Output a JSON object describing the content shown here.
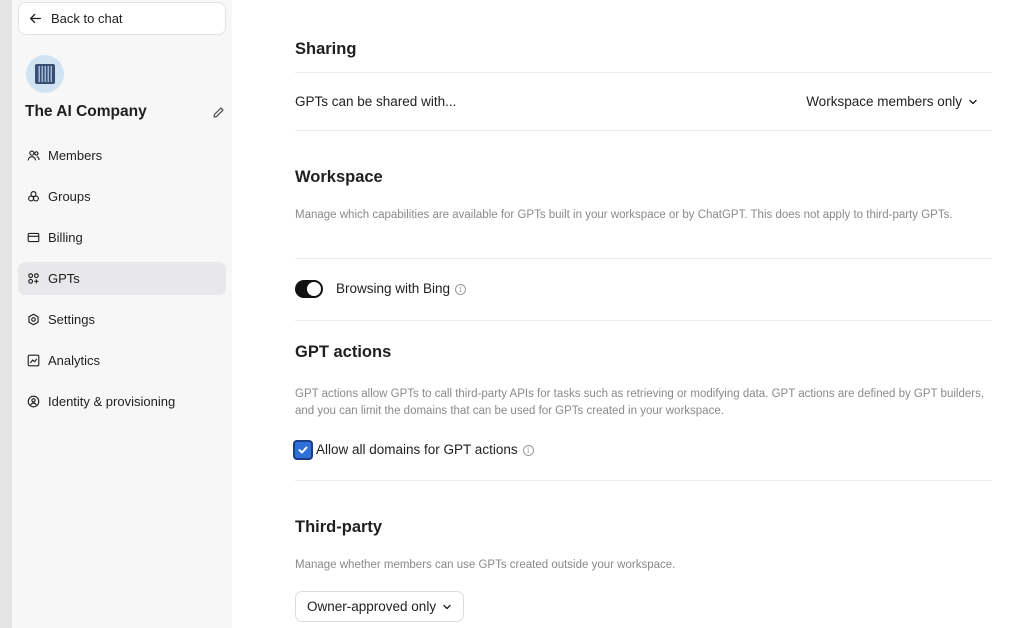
{
  "sidebar": {
    "back_label": "Back to chat",
    "company_name": "The AI Company",
    "items": [
      {
        "label": "Members",
        "icon": "members-icon"
      },
      {
        "label": "Groups",
        "icon": "groups-icon"
      },
      {
        "label": "Billing",
        "icon": "billing-icon"
      },
      {
        "label": "GPTs",
        "icon": "gpts-icon",
        "active": true
      },
      {
        "label": "Settings",
        "icon": "settings-icon"
      },
      {
        "label": "Analytics",
        "icon": "analytics-icon"
      },
      {
        "label": "Identity & provisioning",
        "icon": "identity-icon"
      }
    ]
  },
  "sharing": {
    "title": "Sharing",
    "row_label": "GPTs can be shared with...",
    "selected": "Workspace members only"
  },
  "workspace": {
    "title": "Workspace",
    "description": "Manage which capabilities are available for GPTs built in your workspace or by ChatGPT. This does not apply to third-party GPTs.",
    "toggle_label": "Browsing with Bing",
    "toggle_on": true
  },
  "gpt_actions": {
    "title": "GPT actions",
    "description": "GPT actions allow GPTs to call third-party APIs for tasks such as retrieving or modifying data. GPT actions are defined by GPT builders, and you can limit the domains that can be used for GPTs created in your workspace.",
    "checkbox_label": "Allow all domains for GPT actions",
    "checked": true
  },
  "third_party": {
    "title": "Third-party",
    "description": "Manage whether members can use GPTs created outside your workspace.",
    "selected": "Owner-approved only"
  },
  "colors": {
    "checkbox_accent": "#2f6fd8",
    "toggle_on": "#111111",
    "sidebar_bg": "#f7f7f8"
  }
}
